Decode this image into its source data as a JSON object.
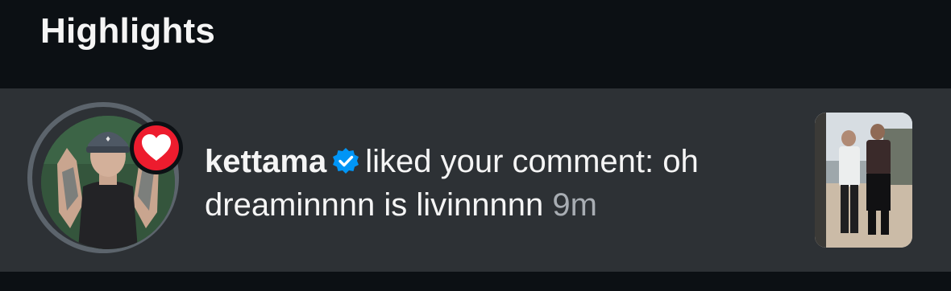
{
  "section": {
    "title": "Highlights"
  },
  "notification": {
    "username": "kettama",
    "action_text": "liked your comment: oh dreaminnnn is livinnnnn",
    "time": "9m",
    "badge_icon": "heart-icon",
    "verified_icon": "verified-badge-icon"
  },
  "colors": {
    "background": "#0c1014",
    "row_highlight": "#2d3135",
    "text_primary": "#f5f5f5",
    "text_secondary": "#a8adb3",
    "verified_blue": "#0095f6",
    "heart_red": "#ed1c2e"
  }
}
